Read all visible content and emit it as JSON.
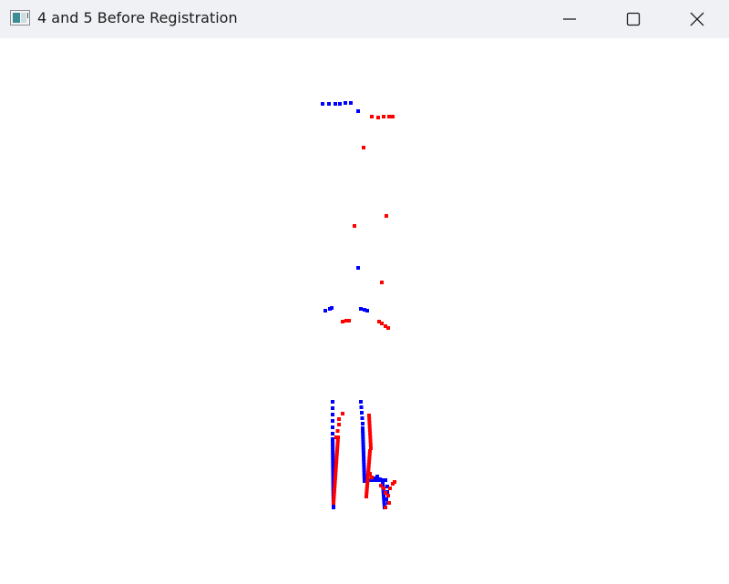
{
  "window": {
    "title": "4 and 5 Before Registration",
    "icons": {
      "app": "app-window-icon",
      "minimize": "minimize-icon",
      "maximize": "maximize-icon",
      "close": "close-icon"
    }
  },
  "colors": {
    "titlebar_bg": "#eff1f5",
    "canvas_bg": "#ffffff",
    "cloud_a": "#0000ff",
    "cloud_b": "#ff0000"
  },
  "point_clouds": [
    {
      "name": "",
      "color": "#0000ff",
      "role": "cloud_a"
    },
    {
      "name": "",
      "color": "#ff0000",
      "role": "cloud_b"
    }
  ]
}
